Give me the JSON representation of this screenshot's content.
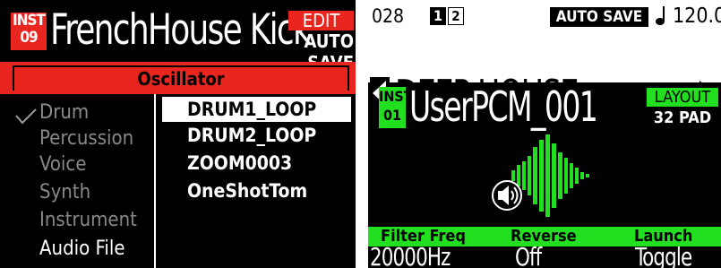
{
  "left_screen": {
    "inst_label": "INST",
    "inst_number": "09",
    "title": "FrenchHouse Kick",
    "edit_label": "EDIT",
    "autosave_label": "AUTO SAVE",
    "section": "Oscillator",
    "categories": [
      {
        "label": "Drum",
        "checked": true
      },
      {
        "label": "Percussion"
      },
      {
        "label": "Voice"
      },
      {
        "label": "Synth"
      },
      {
        "label": "Instrument"
      },
      {
        "label": "Audio File",
        "highlighted": true
      }
    ],
    "files": [
      {
        "label": "DRUM1_LOOP",
        "selected": true
      },
      {
        "label": "DRUM2_LOOP"
      },
      {
        "label": "ZOOM0003"
      },
      {
        "label": "OneShotTom"
      }
    ],
    "colors": {
      "accent": "#e8251f",
      "background": "#000000",
      "text": "#ffffff",
      "dim_text": "#8a8a8a"
    }
  },
  "right_screen": {
    "kit_number": "028",
    "bank_a": "1",
    "bank_b": "2",
    "autosave_label": "AUTO SAVE",
    "note_icon": "note-icon",
    "tempo": "120.0",
    "kit_name": "DEEP HOUSE",
    "inst_label": "INST",
    "inst_number": "01",
    "sample_name": "UserPCM_001",
    "layout_label": "LAYOUT",
    "layout_value": "32 PAD",
    "speaker_icon": "speaker-icon",
    "params": [
      {
        "label": "Filter Freq",
        "value": "20000Hz"
      },
      {
        "label": "Reverse",
        "value": "Off"
      },
      {
        "label": "Launch",
        "value": "Toggle"
      }
    ],
    "colors": {
      "accent": "#22e01f",
      "background": "#000000",
      "top_bar": "#ffffff"
    }
  }
}
